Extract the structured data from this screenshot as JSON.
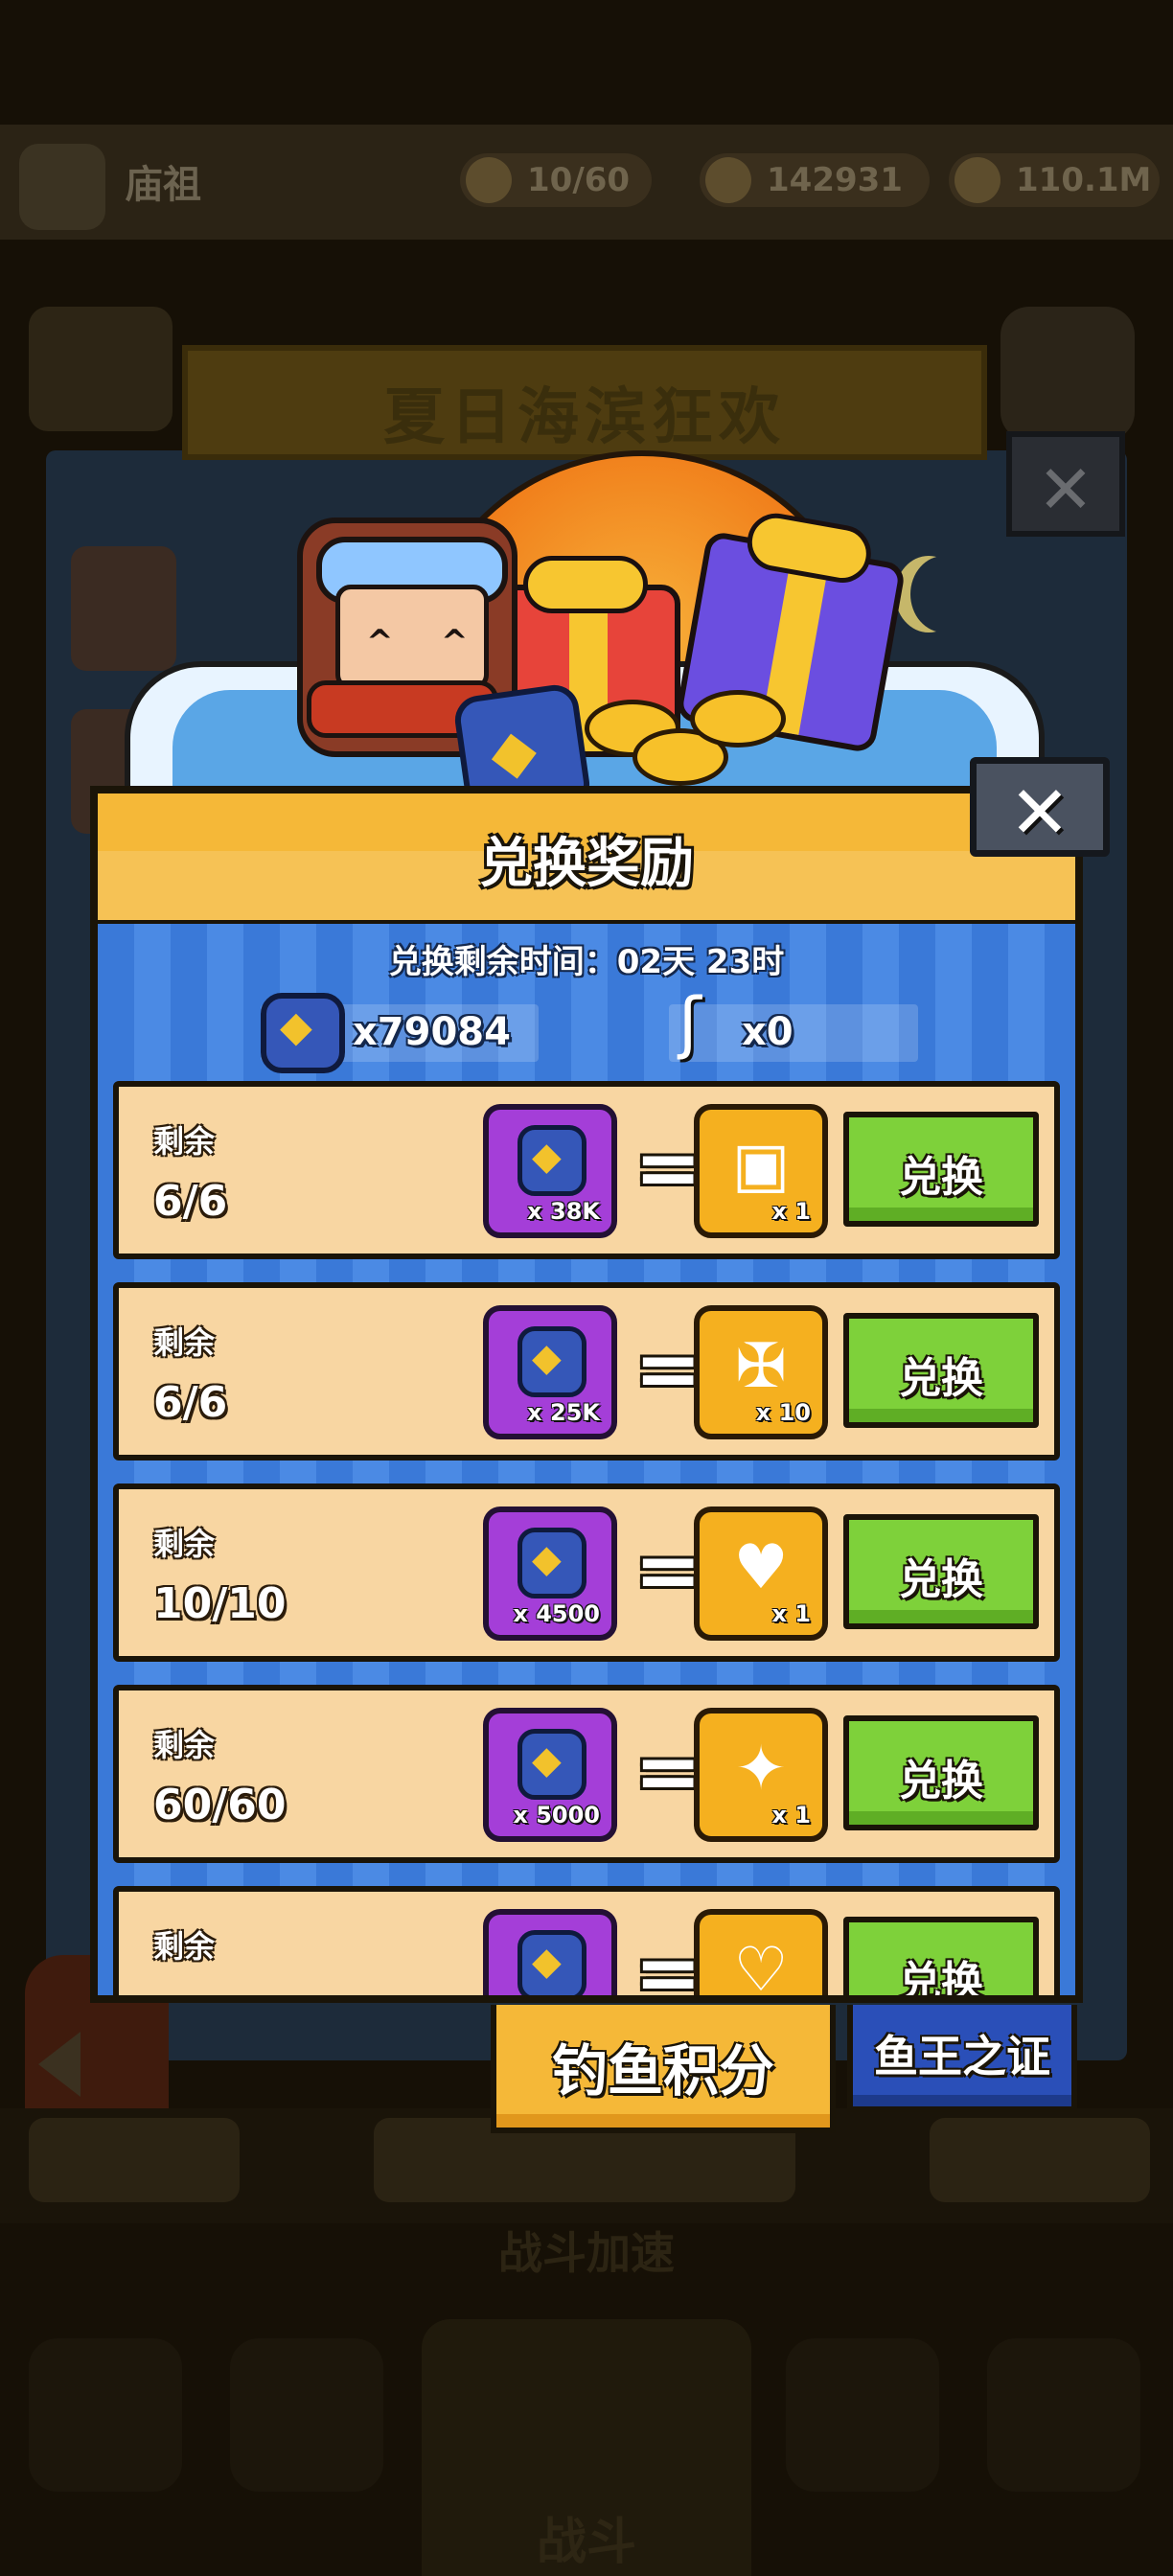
{
  "background": {
    "player_name": "庙祖",
    "stamina": "10/60",
    "gems": "142931",
    "gold": "110.1M",
    "event_banner": "夏日海滨狂欢",
    "battle_boost": "战斗加速",
    "nav_battle": "战斗"
  },
  "modal": {
    "title": "兑换奖励",
    "close_symbol": "✕",
    "timer_text": "兑换剩余时间：02天 23时",
    "currencies": [
      {
        "icon": "fish-shield-token-icon",
        "value": "x79084"
      },
      {
        "icon": "fishing-hook-icon",
        "value": "x0"
      }
    ],
    "remain_label": "剩余",
    "rows": [
      {
        "remaining": "6/6",
        "cost": "x 38K",
        "reward_icon": "treasure-chest-icon",
        "reward_qty": "x 1",
        "button": "兑换"
      },
      {
        "remaining": "6/6",
        "cost": "x 25K",
        "reward_icon": "s-rank-scroll-icon",
        "reward_qty": "x 10",
        "button": "兑换"
      },
      {
        "remaining": "10/10",
        "cost": "x 4500",
        "reward_icon": "heart-chest-icon",
        "reward_qty": "x 1",
        "button": "兑换"
      },
      {
        "remaining": "60/60",
        "cost": "x 5000",
        "reward_icon": "gold-star-icon",
        "reward_qty": "x 1",
        "button": "兑换"
      },
      {
        "remaining": "",
        "cost": "",
        "reward_icon": "ribbon-heart-icon",
        "reward_qty": "",
        "button": "兑换"
      }
    ]
  },
  "tabs": [
    {
      "label": "钓鱼积分",
      "active": true
    },
    {
      "label": "鱼王之证",
      "active": false
    }
  ],
  "colors": {
    "header_yellow": "#f5b838",
    "body_blue": "#3a79d8",
    "row_beige": "#f8d6a2",
    "button_green": "#7ed13a",
    "cost_purple": "#a43ed8",
    "reward_gold": "#f5b01f",
    "tab_blue": "#2a4fb8"
  }
}
